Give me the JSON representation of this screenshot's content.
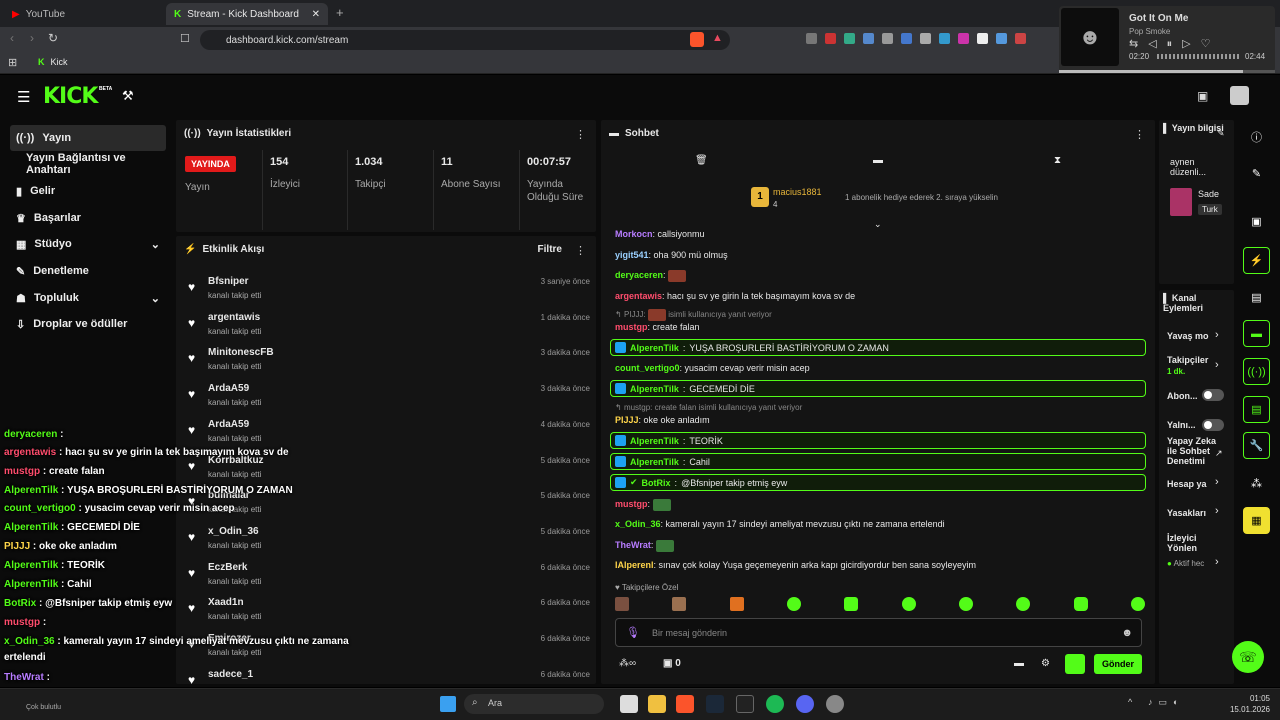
{
  "browser": {
    "tab1": "YouTube",
    "tab2": "Stream - Kick Dashboard",
    "url": "dashboard.kick.com/stream",
    "bookmark": "Kick"
  },
  "media": {
    "title": "Got It On Me",
    "artist": "Pop Smoke",
    "elapsed": "02:20",
    "total": "02:44"
  },
  "app": {
    "logo": "KICK",
    "beta": "BETA"
  },
  "sidebar": [
    {
      "icon": "broadcast-icon",
      "label": "Yayın"
    },
    {
      "icon": "",
      "label": "Yayın Bağlantısı ve Anahtarı"
    },
    {
      "icon": "revenue-icon",
      "label": "Gelir"
    },
    {
      "icon": "trophy-icon",
      "label": "Başarılar"
    },
    {
      "icon": "studio-icon",
      "label": "Stüdyo"
    },
    {
      "icon": "moderation-icon",
      "label": "Denetleme"
    },
    {
      "icon": "community-icon",
      "label": "Topluluk"
    },
    {
      "icon": "drops-icon",
      "label": "Droplar ve ödüller"
    }
  ],
  "stats": {
    "title": "Yayın İstatistikleri",
    "live_badge": "YAYINDA",
    "stream_label": "Yayın",
    "viewers": "154",
    "viewers_label": "İzleyici",
    "followers": "1.034",
    "followers_label": "Takipçi",
    "subs": "11",
    "subs_label": "Abone Sayısı",
    "uptime": "00:07:57",
    "uptime_label": "Yayında Olduğu Süre"
  },
  "events": {
    "title": "Etkinlik Akışı",
    "filter": "Filtre",
    "sub": "kanalı takip etti",
    "items": [
      {
        "name": "Bfsniper",
        "time": "3 saniye önce"
      },
      {
        "name": "argentawis",
        "time": "1 dakika önce"
      },
      {
        "name": "MinitonescFB",
        "time": "3 dakika önce"
      },
      {
        "name": "ArdaA59",
        "time": "3 dakika önce"
      },
      {
        "name": "ArdaA59",
        "time": "4 dakika önce"
      },
      {
        "name": "Korrbaltkuz",
        "time": "5 dakika önce"
      },
      {
        "name": "bulinalar",
        "time": "5 dakika önce"
      },
      {
        "name": "x_Odin_36",
        "time": "5 dakika önce"
      },
      {
        "name": "EczBerk",
        "time": "6 dakika önce"
      },
      {
        "name": "Xaad1n",
        "time": "6 dakika önce"
      },
      {
        "name": "Emirozer",
        "time": "6 dakika önce"
      },
      {
        "name": "sadece_1",
        "time": "6 dakika önce"
      }
    ]
  },
  "chat": {
    "title": "Sohbet",
    "pinned_user": "macius1881",
    "pinned_count": "4",
    "pinned_msg": "1 abonelik hediye ederek 2. sıraya yükselin",
    "lines": [
      {
        "user": "Morkocn",
        "color": "#b77cff",
        "text": "callsiyonmu"
      },
      {
        "user": "yigit541",
        "color": "#9ad0ff",
        "text": "oha 900 mü olmuş"
      },
      {
        "user": "deryaceren",
        "color": "#53fc18",
        "text": "",
        "emote": true
      },
      {
        "user": "argentawis",
        "color": "#ff4d6d",
        "text": "hacı şu sv ye girin la tek başımayım kova sv de"
      },
      {
        "user": "",
        "color": "#888",
        "text": "isimli kullanıcıya yanıt veriyor",
        "reply": "PIJJJ:"
      },
      {
        "user": "mustgp",
        "color": "#ff4d6d",
        "text": "create falan"
      }
    ],
    "hl1": {
      "user": "AlperenTilk",
      "text": "YUŞA BROŞURLERİ BASTİRİYORUM O ZAMAN"
    },
    "l2": {
      "user": "count_vertigo0",
      "text": "yusacim cevap verir misin acep"
    },
    "hl2": {
      "user": "AlperenTilk",
      "text": "GECEMEDİ DİE"
    },
    "reply2": "mustgp: create falan isimli kullanıcıya yanıt veriyor",
    "l3": {
      "user": "PIJJJ",
      "text": "oke oke anladım"
    },
    "hl3": {
      "user": "AlperenTilk",
      "text": "TEORİK"
    },
    "hl4": {
      "user": "AlperenTilk",
      "text": "Cahil"
    },
    "hl5": {
      "user": "BotRix",
      "text": "@Bfsniper takip etmiş eyw"
    },
    "l4": {
      "user": "mustgp",
      "text": ""
    },
    "l5": {
      "user": "x_Odin_36",
      "text": "kameralı yayın 17 sindeyi ameliyat mevzusu çıktı ne zamana ertelendi"
    },
    "l6": {
      "user": "TheWrat",
      "text": ""
    },
    "l7": {
      "user": "IAlperenl",
      "text": "sınav çok kolay Yuşa geçemeyenin arka kapı gicirdiyordur ben sana soyleyeyim"
    },
    "emote_label": "Takipçilere Özel",
    "placeholder": "Bir mesaj gönderin",
    "points": "0",
    "send": "Gönder"
  },
  "info": {
    "title": "Yayın bilgisi",
    "line1": "aynen",
    "line2": "düzenli...",
    "cat": "Sade",
    "tag": "Turk"
  },
  "actions": {
    "title": "Kanal Eylemleri",
    "slow": "Yavaş mo",
    "followers": "Takipçiler",
    "followers_sub": "1 dk.",
    "subs": "Abon...",
    "only": "Yalnı...",
    "ai": "Yapay Zeka ile Sohbet Denetimi",
    "account": "Hesap ya",
    "bans": "Yasakları",
    "viewer": "İzleyici Yönlen",
    "active": "Aktif hec"
  },
  "overlay": [
    {
      "u": "deryaceren",
      "c": "#53fc18",
      "t": " : "
    },
    {
      "u": "argentawis",
      "c": "#ff4d6d",
      "t": " : hacı şu sv ye girin la tek başımayım kova sv de"
    },
    {
      "u": "mustgp",
      "c": "#ff4d6d",
      "t": " : create falan"
    },
    {
      "u": "AlperenTilk",
      "c": "#53fc18",
      "t": " : YUŞA BROŞURLERİ BASTİRİYORUM O ZAMAN"
    },
    {
      "u": "count_vertigo0",
      "c": "#53fc18",
      "t": " : yusacim cevap verir misin acep"
    },
    {
      "u": "AlperenTilk",
      "c": "#53fc18",
      "t": " : GECEMEDİ DİE"
    },
    {
      "u": "PIJJJ",
      "c": "#ffd54a",
      "t": " : oke oke anladım"
    },
    {
      "u": "AlperenTilk",
      "c": "#53fc18",
      "t": " : TEORİK"
    },
    {
      "u": "AlperenTilk",
      "c": "#53fc18",
      "t": " : Cahil"
    },
    {
      "u": "BotRix",
      "c": "#53fc18",
      "t": " : @Bfsniper takip etmiş eyw"
    },
    {
      "u": "mustgp",
      "c": "#ff4d6d",
      "t": " : "
    },
    {
      "u": "x_Odin_36",
      "c": "#53fc18",
      "t": " : kameralı yayın 17 sindeyi ameliyat mevzusu çıktı ne zamana"
    },
    {
      "u": "",
      "c": "#fff",
      "t": "ertelendi"
    },
    {
      "u": "TheWrat",
      "c": "#b77cff",
      "t": " : "
    },
    {
      "u": "IAlperenl",
      "c": "#ffd54a",
      "t": " : sınav çok kolay Yuşa geçemeyenin arka kapı gicirdiyordur ben sana"
    },
    {
      "u": "",
      "c": "#fff",
      "t": "soyleyeyim"
    }
  ],
  "taskbar": {
    "search": "Ara",
    "weather": "Çok bulutlu",
    "time": "01:05",
    "date": "15.01.2026"
  }
}
